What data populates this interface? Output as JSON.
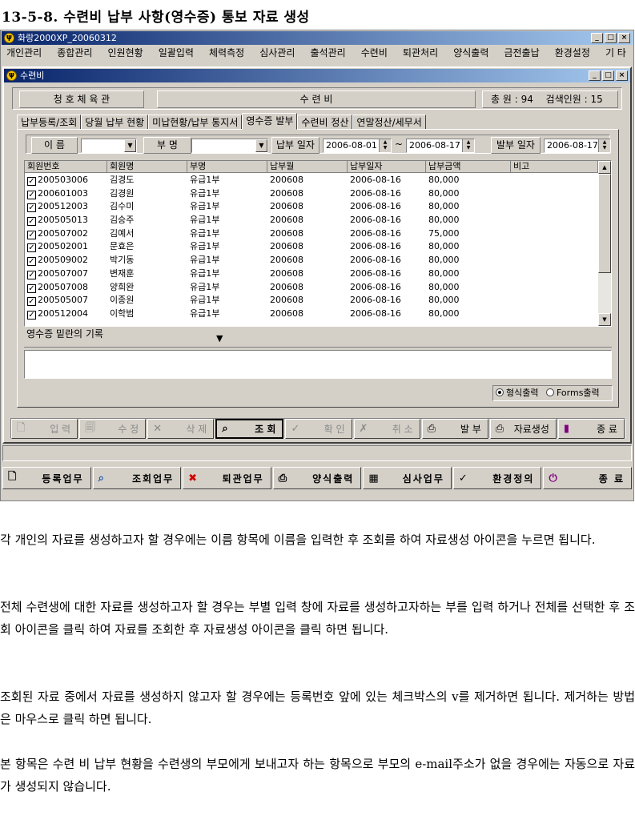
{
  "heading": "13-5-8. 수련비 납부 사항(영수증) 통보 자료 생성",
  "app": {
    "title": "화랑2000XP_20060312",
    "menu": [
      "개인관리",
      "종합관리",
      "인원현황",
      "일괄입력",
      "체력측정",
      "심사관리",
      "출석관리",
      "수련비",
      "퇴관처리",
      "양식출력",
      "금전출납",
      "환경설정",
      "기 타"
    ],
    "window_buttons": [
      "_",
      "□",
      "×"
    ]
  },
  "child": {
    "title": "수련비",
    "gym_name": "청 호 체 육 관",
    "module_name": "수 련 비",
    "total_label": "총 원 : 94",
    "search_label": "검색인원 : 15",
    "tabs": [
      "납부등록/조회",
      "당월 납부 현황",
      "미납현황/납부 통지서",
      "영수증 발부",
      "수련비 정산",
      "연말정산/세무서"
    ],
    "active_tab": 3,
    "filter": {
      "name_label": "이 름",
      "dept_label": "부 명",
      "pay_date_label": "납부 일자",
      "from_date": "2006-08-01",
      "tilde": "~",
      "to_date": "2006-08-17",
      "issue_date_label": "발부 일자",
      "issue_date": "2006-08-17"
    },
    "grid": {
      "columns": [
        "회원번호",
        "회원명",
        "부명",
        "납부월",
        "납부일자",
        "납부금액",
        "비고"
      ],
      "rows": [
        [
          "200503006",
          "김경도",
          "유급1부",
          "200608",
          "2006-08-16",
          "80,000",
          ""
        ],
        [
          "200601003",
          "김경원",
          "유급1부",
          "200608",
          "2006-08-16",
          "80,000",
          ""
        ],
        [
          "200512003",
          "김수미",
          "유급1부",
          "200608",
          "2006-08-16",
          "80,000",
          ""
        ],
        [
          "200505013",
          "김승주",
          "유급1부",
          "200608",
          "2006-08-16",
          "80,000",
          ""
        ],
        [
          "200507002",
          "김예서",
          "유급1부",
          "200608",
          "2006-08-16",
          "75,000",
          ""
        ],
        [
          "200502001",
          "문효은",
          "유급1부",
          "200608",
          "2006-08-16",
          "80,000",
          ""
        ],
        [
          "200509002",
          "박기동",
          "유급1부",
          "200608",
          "2006-08-16",
          "80,000",
          ""
        ],
        [
          "200507007",
          "변재훈",
          "유급1부",
          "200608",
          "2006-08-16",
          "80,000",
          ""
        ],
        [
          "200507008",
          "양희완",
          "유급1부",
          "200608",
          "2006-08-16",
          "80,000",
          ""
        ],
        [
          "200505007",
          "이종원",
          "유급1부",
          "200608",
          "2006-08-16",
          "80,000",
          ""
        ],
        [
          "200512004",
          "이학범",
          "유급1부",
          "200608",
          "2006-08-16",
          "80,000",
          ""
        ]
      ]
    },
    "memo_label": "영수증 밑란의 기록",
    "radio_form": "형식출력",
    "radio_forms": "Forms출력",
    "toolbar": [
      "입 력",
      "수 정",
      "삭 제",
      "조 회",
      "확 인",
      "취 소",
      "발 부",
      "자료생성",
      "종 료"
    ],
    "bottom_toolbar": [
      "등록업무",
      "조회업무",
      "퇴관업무",
      "양식출력",
      "심사업무",
      "환경정의",
      "종 료"
    ]
  },
  "paragraphs": [
    "각 개인의 자료를 생성하고자 할 경우에는 이름 항목에 이름을 입력한 후 조회를 하여 자료생성 아이콘을 누르면 됩니다.",
    "전체 수련생에 대한 자료를 생성하고자 할 경우는 부별 입력 창에 자료를 생성하고자하는 부를 입력 하거나 전체를 선택한 후 조회 아이콘을 클릭 하여 자료를 조회한 후 자료생성 아이콘을 클릭 하면 됩니다.",
    "조회된 자료 중에서 자료를 생성하지 않고자 할 경우에는 등록번호 앞에 있는 체크박스의 v를 제거하면 됩니다. 제거하는 방법은 마우스로 클릭 하면 됩니다.",
    "본 항목은 수련 비 납부 현황을 수련생의 부모에게 보내고자 하는 항목으로 부모의 e-mail주소가 없을 경우에는 자동으로 자료가 생성되지 않습니다."
  ]
}
